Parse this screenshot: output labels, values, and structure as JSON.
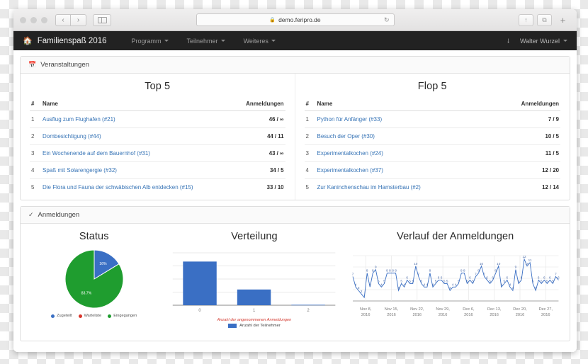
{
  "browser": {
    "url": "demo.feripro.de",
    "lock_icon": "lock-icon",
    "reload_icon": "reload-icon",
    "back_icon": "‹",
    "forward_icon": "›",
    "share_icon": "↑",
    "tabs_icon": "⧉",
    "new_tab_icon": "+"
  },
  "navbar": {
    "home_icon": "home-icon",
    "brand": "Familienspaß 2016",
    "links": [
      {
        "label": "Programm"
      },
      {
        "label": "Teilnehmer"
      },
      {
        "label": "Weiteres"
      }
    ],
    "download_icon": "↓",
    "user": "Walter Wurzel"
  },
  "panels": {
    "events": {
      "icon": "calendar-icon",
      "title": "Veranstaltungen",
      "top": {
        "title": "Top 5",
        "columns": {
          "rank": "#",
          "name": "Name",
          "count": "Anmeldungen"
        },
        "rows": [
          {
            "rank": "1",
            "name": "Ausflug zum Flughafen (#21)",
            "count": "46 / ∞"
          },
          {
            "rank": "2",
            "name": "Dombesichtigung (#44)",
            "count": "44 / 11"
          },
          {
            "rank": "3",
            "name": "Ein Wochenende auf dem Bauernhof (#31)",
            "count": "43 / ∞"
          },
          {
            "rank": "4",
            "name": "Spaß mit Solarengergie (#32)",
            "count": "34 / 5"
          },
          {
            "rank": "5",
            "name": "Die Flora und Fauna der schwäbischen Alb entdecken (#15)",
            "count": "33 / 10"
          }
        ]
      },
      "flop": {
        "title": "Flop 5",
        "columns": {
          "rank": "#",
          "name": "Name",
          "count": "Anmeldungen"
        },
        "rows": [
          {
            "rank": "1",
            "name": "Python für Anfänger (#33)",
            "count": "7 / 9"
          },
          {
            "rank": "2",
            "name": "Besuch der Oper (#30)",
            "count": "10 / 5"
          },
          {
            "rank": "3",
            "name": "Experimentalkochen (#24)",
            "count": "11 / 5"
          },
          {
            "rank": "4",
            "name": "Experimentalkochen (#37)",
            "count": "12 / 20"
          },
          {
            "rank": "5",
            "name": "Zur Kaninchenschau im Hamsterbau (#2)",
            "count": "12 / 14"
          }
        ]
      }
    },
    "registrations": {
      "icon": "check-icon",
      "title": "Anmeldungen"
    }
  },
  "colors": {
    "blue": "#3a6fc4",
    "green": "#1f9d2f",
    "red": "#d8342a",
    "link": "#3774b6",
    "navbar_bg": "#222222",
    "axis_label_red": "#d3392f"
  },
  "chart_data": [
    {
      "type": "pie",
      "title": "Status",
      "labels": [
        "Zugeteilt",
        "Warteliste",
        "Eingegangen"
      ],
      "values": [
        16.3,
        0,
        83.7
      ],
      "slice_labels": [
        "16%",
        "",
        "83.7%"
      ],
      "colors": [
        "#3a6fc4",
        "#d8342a",
        "#1f9d2f"
      ],
      "legend_position": "bottom"
    },
    {
      "type": "bar",
      "title": "Verteilung",
      "categories": [
        "0",
        "1",
        "2"
      ],
      "values": [
        100,
        36,
        1
      ],
      "series": [
        {
          "name": "Anzahl der Teilnehmer",
          "values": [
            100,
            36,
            1
          ]
        }
      ],
      "xlabel": "Anzahl der angenommenen Anmeldungen",
      "ylabel": "",
      "ylim": [
        0,
        120
      ],
      "grid": true,
      "legend_position": "bottom",
      "color": "#3a6fc4"
    },
    {
      "type": "line",
      "title": "Verlauf der Anmeldungen",
      "xlabel": "",
      "ylabel": "",
      "ylim": [
        0,
        13
      ],
      "grid": true,
      "color": "#3a6fc4",
      "tick_labels": [
        "Nov 8,\n2016",
        "Nov 15,\n2016",
        "Nov 22,\n2016",
        "Nov 29,\n2016",
        "Dec 6,\n2016",
        "Dec 13,\n2016",
        "Dec 20,\n2016",
        "Dec 27,\n2016"
      ],
      "tick_lines": [
        "Nov 8,",
        "Nov 15,",
        "Nov 22,",
        "Nov 29,",
        "Dec 6,",
        "Dec 13,",
        "Dec 20,",
        "Dec 27,"
      ],
      "tick_year": "2016",
      "values": [
        7,
        4,
        3,
        2,
        1,
        8,
        4,
        8,
        9,
        5,
        4,
        5,
        8,
        8,
        8,
        8,
        3,
        5,
        4,
        6,
        5,
        5,
        10,
        7,
        5,
        4,
        4,
        8,
        4,
        5,
        6,
        6,
        5,
        5,
        3,
        4,
        4,
        5,
        8,
        8,
        5,
        6,
        5,
        7,
        8,
        10,
        7,
        6,
        5,
        6,
        8,
        10,
        4,
        5,
        6,
        4,
        3,
        9,
        5,
        6,
        12,
        10,
        11,
        5,
        3,
        6,
        5,
        6,
        5,
        6,
        5,
        7,
        6
      ],
      "point_labels": [
        "7",
        "4",
        "3",
        "2",
        "",
        "8",
        "4",
        "8",
        "9",
        "5",
        "4",
        "5",
        "8",
        "8",
        "8",
        "8",
        "3",
        "5",
        "4",
        "6",
        "5",
        "5",
        "10",
        "7",
        "5",
        "4",
        "4",
        "8",
        "4",
        "5",
        "6",
        "6",
        "5",
        "5",
        "3",
        "4",
        "4",
        "5",
        "8",
        "8",
        "5",
        "6",
        "5",
        "7",
        "8",
        "10",
        "7",
        "6",
        "5",
        "6",
        "8",
        "10",
        "4",
        "5",
        "6",
        "4",
        "3",
        "9",
        "5",
        "6",
        "12",
        "10",
        "11",
        "5",
        "3",
        "6",
        "5",
        "6",
        "5",
        "6",
        "5",
        "7",
        "6"
      ]
    }
  ]
}
